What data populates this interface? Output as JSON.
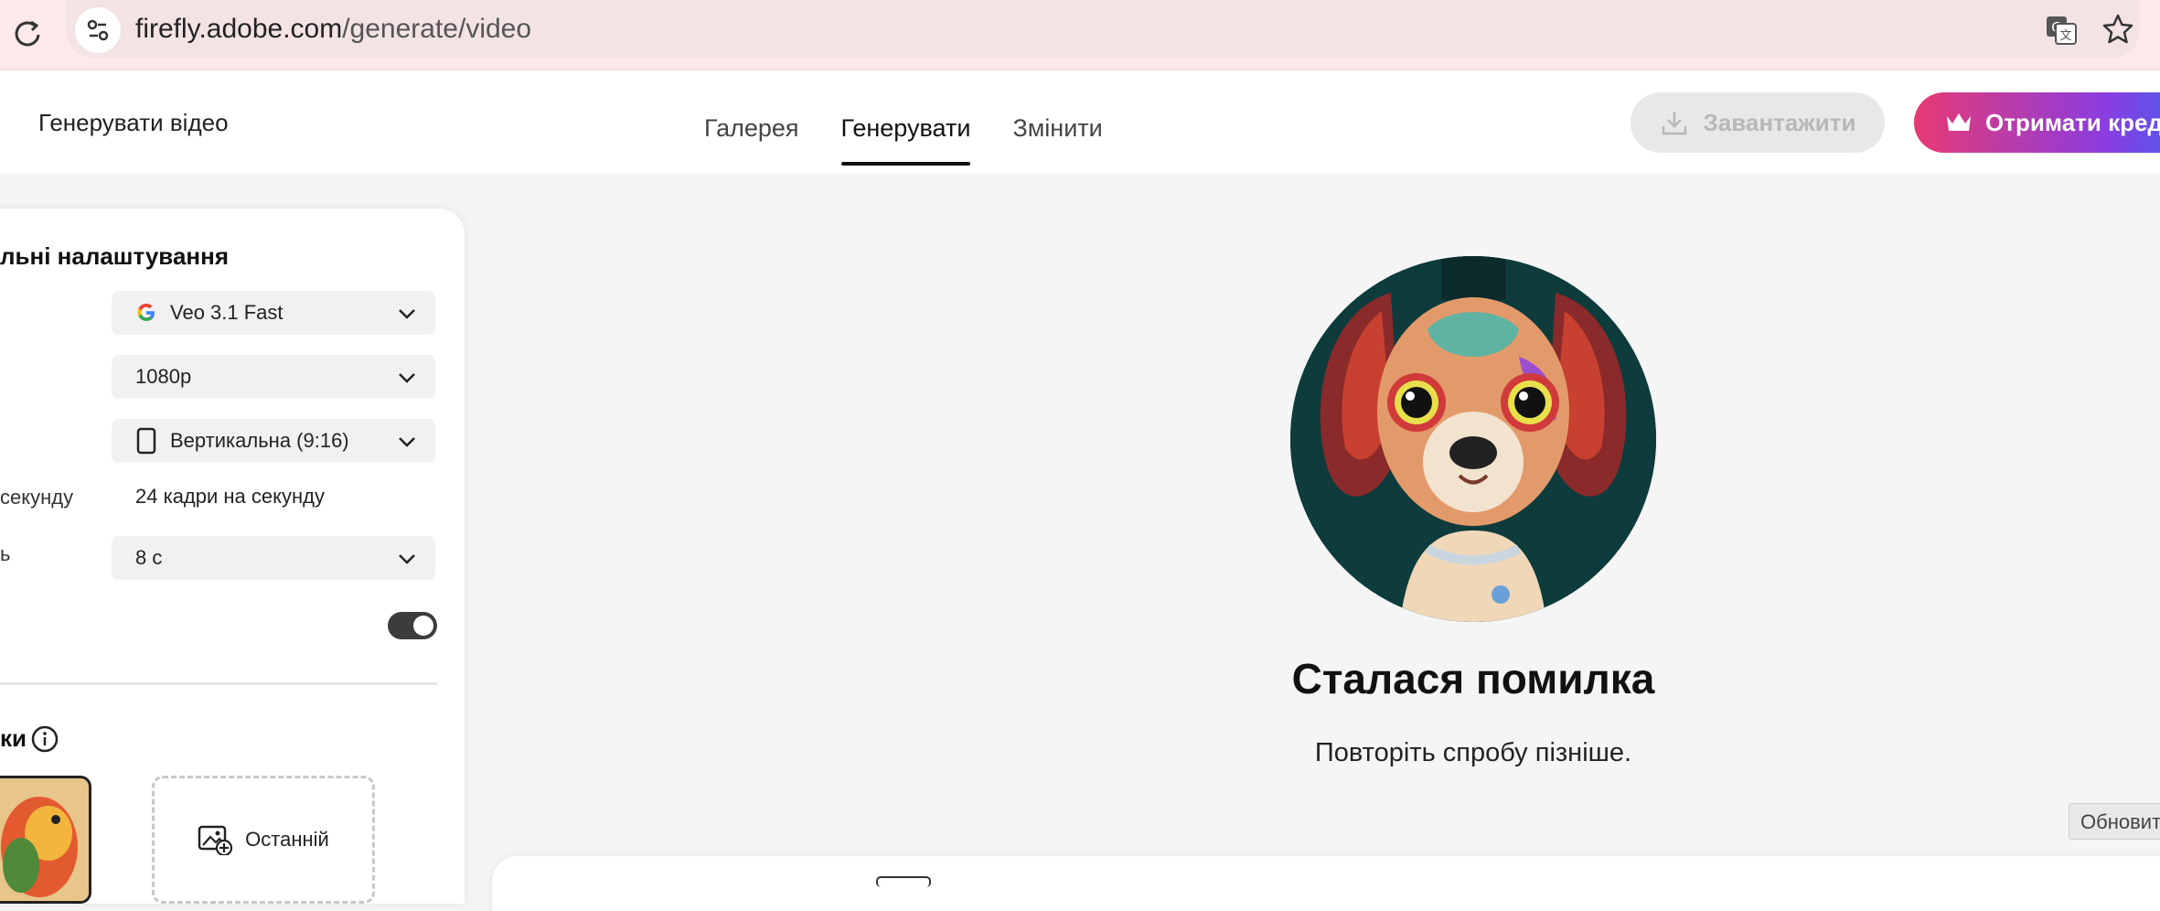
{
  "browser": {
    "url_host": "firefly.adobe.com",
    "url_path": "/generate/video"
  },
  "header": {
    "app_title": "Генерувати відео",
    "tabs": [
      {
        "label": "Галерея",
        "active": false
      },
      {
        "label": "Генерувати",
        "active": true
      },
      {
        "label": "Змінити",
        "active": false
      }
    ],
    "download_label": "Завантажити",
    "credits_label": "Отримати кред"
  },
  "settings": {
    "title": "льні налаштування",
    "model": "Veo 3.1 Fast",
    "resolution": "1080p",
    "aspect_label_fragment": "",
    "aspect": "Вертикальна (9:16)",
    "fps_label_fragment": "секунду",
    "fps_value": "24 кадри на секунду",
    "duration_label_fragment": "ь",
    "duration": "8 с",
    "toggle_on": true,
    "section_label": "ки",
    "recent_label": "Останній"
  },
  "main": {
    "error_title": "Сталася помилка",
    "error_subtitle": "Повторіть спробу пізніше.",
    "update_chip": "Обновит"
  },
  "colors": {
    "accent_gradient_start": "#e83a73",
    "accent_gradient_end": "#4a5ef0"
  }
}
